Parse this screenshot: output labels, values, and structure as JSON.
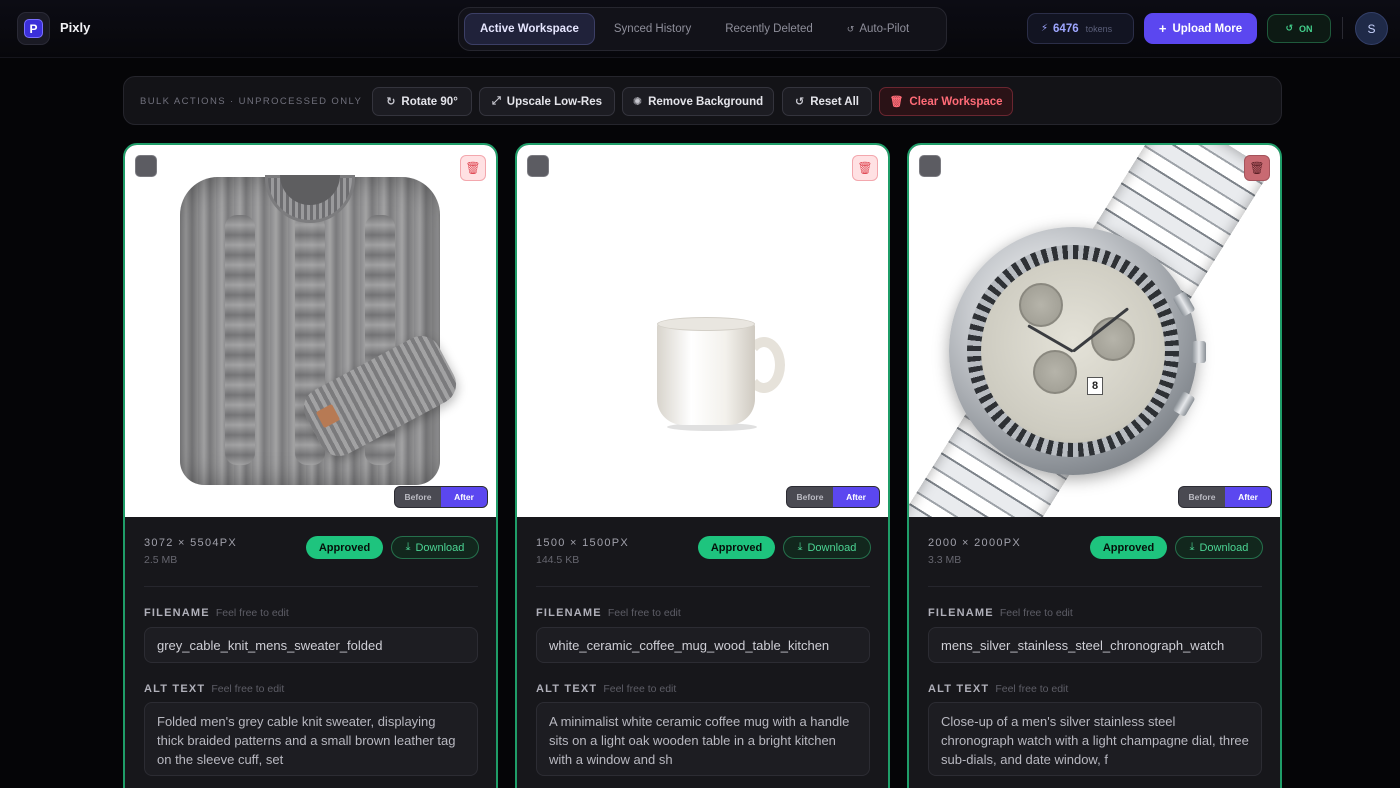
{
  "app": {
    "name": "Pixly",
    "logo_letter": "P"
  },
  "nav": {
    "tabs": [
      {
        "label": "Active Workspace",
        "active": true
      },
      {
        "label": "Synced History",
        "active": false
      },
      {
        "label": "Recently Deleted",
        "active": false
      },
      {
        "label": "Auto-Pilot",
        "active": false
      }
    ]
  },
  "header": {
    "tokens_value": "6476",
    "tokens_unit": "tokens",
    "upload_label": "Upload More",
    "autopilot_state": "ON",
    "avatar_initial": "S",
    "accent_color": "#5b47f0",
    "success_color": "#1ec47e",
    "danger_color": "#ff6b77"
  },
  "bulk": {
    "label": "BULK ACTIONS · UNPROCESSED ONLY",
    "buttons": [
      {
        "label": "Rotate 90°",
        "icon": "rotate-icon"
      },
      {
        "label": "Upscale Low-Res",
        "icon": "expand-icon"
      },
      {
        "label": "Remove Background",
        "icon": "magic-icon"
      },
      {
        "label": "Reset All",
        "icon": "reset-icon"
      },
      {
        "label": "Clear Workspace",
        "icon": "trash-icon"
      }
    ]
  },
  "images": [
    {
      "product": "sweater",
      "dimensions": "3072 × 5504PX",
      "file_size": "2.5 MB",
      "status": "Approved",
      "download_label": "Download",
      "toggle_before": "Before",
      "toggle_after": "After",
      "filename_label": "FILENAME",
      "filename_hint": "Feel free to edit",
      "filename": "grey_cable_knit_mens_sweater_folded",
      "alt_label": "ALT TEXT",
      "alt_hint": "Feel free to edit",
      "alt_text": "Folded men's grey cable knit sweater, displaying thick braided patterns and a small brown leather tag on the sleeve cuff, set"
    },
    {
      "product": "mug",
      "dimensions": "1500 × 1500PX",
      "file_size": "144.5 KB",
      "status": "Approved",
      "download_label": "Download",
      "toggle_before": "Before",
      "toggle_after": "After",
      "filename_label": "FILENAME",
      "filename_hint": "Feel free to edit",
      "filename": "white_ceramic_coffee_mug_wood_table_kitchen",
      "alt_label": "ALT TEXT",
      "alt_hint": "Feel free to edit",
      "alt_text": "A minimalist white ceramic coffee mug with a handle sits on a light oak wooden table in a bright kitchen with a window and sh"
    },
    {
      "product": "watch",
      "dimensions": "2000 × 2000PX",
      "file_size": "3.3 MB",
      "status": "Approved",
      "download_label": "Download",
      "toggle_before": "Before",
      "toggle_after": "After",
      "filename_label": "FILENAME",
      "filename_hint": "Feel free to edit",
      "filename": "mens_silver_stainless_steel_chronograph_watch",
      "alt_label": "ALT TEXT",
      "alt_hint": "Feel free to edit",
      "alt_text": "Close-up of a men's silver stainless steel chronograph watch with a light champagne dial, three sub-dials, and date window, f",
      "date_window": "8"
    }
  ]
}
